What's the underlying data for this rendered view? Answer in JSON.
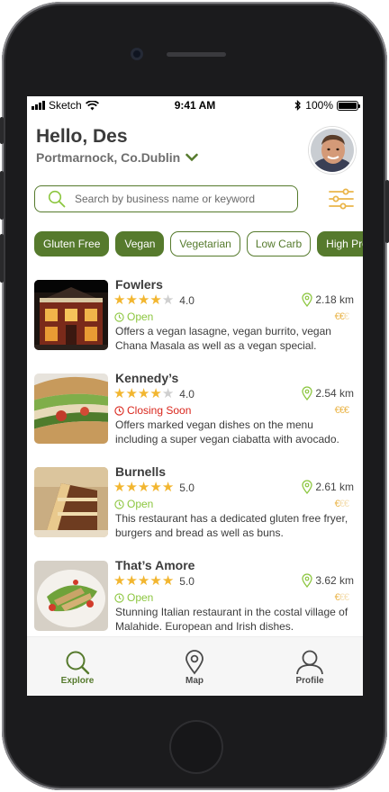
{
  "status_bar": {
    "carrier": "Sketch",
    "time": "9:41 AM",
    "battery": "100%"
  },
  "header": {
    "greeting": "Hello, Des",
    "location": "Portmarnock, Co.Dublin"
  },
  "search": {
    "placeholder": "Search by business name or keyword"
  },
  "filters": [
    {
      "label": "Gluten Free",
      "active": true
    },
    {
      "label": "Vegan",
      "active": true
    },
    {
      "label": "Vegetarian",
      "active": false
    },
    {
      "label": "Low Carb",
      "active": false
    },
    {
      "label": "High Protein",
      "active": false
    }
  ],
  "restaurants": [
    {
      "name": "Fowlers",
      "rating": "4.0",
      "stars": 4,
      "distance": "2.18 km",
      "status": "Open",
      "status_type": "open",
      "price_level": 2,
      "description": "Offers a vegan lasagne, vegan burrito, vegan Chana Masala as well as a vegan special."
    },
    {
      "name": "Kennedy’s",
      "rating": "4.0",
      "stars": 4,
      "distance": "2.54 km",
      "status": "Closing Soon",
      "status_type": "closing",
      "price_level": 3,
      "description": "Offers marked vegan dishes on the menu including a super vegan ciabatta with avocado."
    },
    {
      "name": "Burnells",
      "rating": "5.0",
      "stars": 5,
      "distance": "2.61 km",
      "status": "Open",
      "status_type": "open",
      "price_level": 1,
      "description": "This restaurant has a dedicated gluten free fryer, burgers and bread as well as buns."
    },
    {
      "name": "That’s Amore",
      "rating": "5.0",
      "stars": 5,
      "distance": "3.62 km",
      "status": "Open",
      "status_type": "open",
      "price_level": 1,
      "description": "Stunning Italian restaurant in the costal village of Malahide. European and Irish dishes."
    }
  ],
  "tabs": {
    "explore": "Explore",
    "map": "Map",
    "profile": "Profile"
  },
  "colors": {
    "brand_green": "#567a2d",
    "open_green": "#8cc63f",
    "closing_red": "#d9261c",
    "star_yellow": "#f2b630",
    "price_gold": "#eab54a"
  },
  "icons": {
    "search": "search-icon",
    "filter": "sliders-icon",
    "location": "map-pin-icon",
    "clock": "clock-icon",
    "explore": "search-icon",
    "map": "map-pin-icon",
    "profile": "user-icon"
  }
}
